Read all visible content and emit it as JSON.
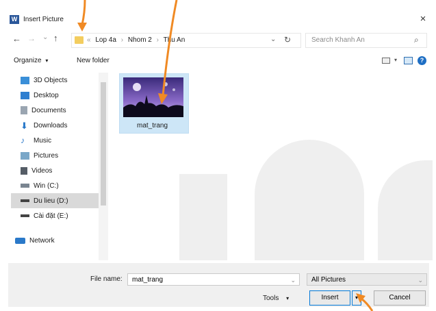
{
  "window": {
    "title": "Insert Picture",
    "close_glyph": "×"
  },
  "nav": {
    "back_glyph": "←",
    "forward_glyph": "→",
    "recent_glyph": "⌄",
    "up_glyph": "↑",
    "address": [
      "Lop 4a",
      "Nhom 2",
      "Thu An"
    ],
    "address_prefix": "«",
    "separator": "›",
    "dropdown_glyph": "⌄",
    "refresh_glyph": "↻",
    "search_placeholder": "Search Khanh An",
    "search_glyph": "⌕"
  },
  "toolbar": {
    "organize": "Organize",
    "organize_arrow": "▾",
    "new_folder": "New folder",
    "help": "?"
  },
  "sidebar": {
    "items": [
      {
        "label": "3D Objects",
        "icon": "3d-objects-icon",
        "color": "#3a8fd8"
      },
      {
        "label": "Desktop",
        "icon": "desktop-icon",
        "color": "#2f7fd0"
      },
      {
        "label": "Documents",
        "icon": "documents-icon",
        "color": "#9aa5b1"
      },
      {
        "label": "Downloads",
        "icon": "downloads-icon",
        "color": "#2a79c9"
      },
      {
        "label": "Music",
        "icon": "music-icon",
        "color": "#2a79c9"
      },
      {
        "label": "Pictures",
        "icon": "pictures-icon",
        "color": "#7aa7c8"
      },
      {
        "label": "Videos",
        "icon": "videos-icon",
        "color": "#555d66"
      },
      {
        "label": "Win (C:)",
        "icon": "drive-icon",
        "color": "#7a8590"
      },
      {
        "label": "Du lieu (D:)",
        "icon": "drive-icon",
        "color": "#444"
      },
      {
        "label": "Cài đặt (E:)",
        "icon": "drive-icon",
        "color": "#444"
      },
      {
        "label": "Network",
        "icon": "network-icon",
        "color": "#2a79c9"
      }
    ]
  },
  "files": [
    {
      "name": "mat_trang"
    }
  ],
  "bottom": {
    "file_name_label": "File name:",
    "file_name_value": "mat_trang",
    "filter_value": "All Pictures",
    "tools": "Tools",
    "tools_arrow": "▾",
    "insert": "Insert",
    "insert_arrow": "▾",
    "cancel": "Cancel"
  },
  "colors": {
    "arrow": "#f08a24",
    "selected_tile": "#cde6f7",
    "selected_drive": "#d9d9d9"
  }
}
